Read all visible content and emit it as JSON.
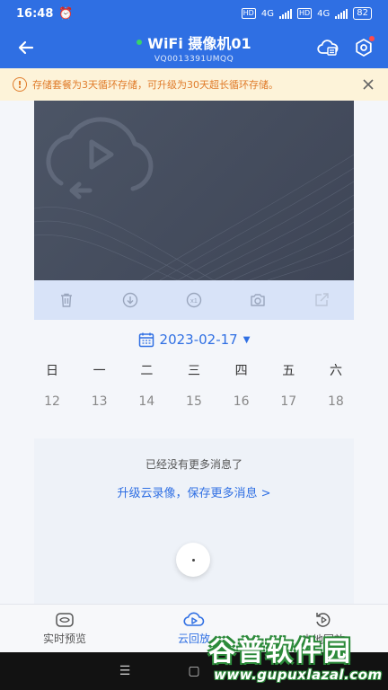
{
  "status_bar": {
    "time": "16:48",
    "net1": "4G",
    "net2": "4G",
    "hd1": "HD",
    "hd2": "HD",
    "battery": "82"
  },
  "header": {
    "title": "WiFi 摄像机01",
    "subtitle": "VQ0013391UMQQ",
    "online_color": "#37d46a"
  },
  "notice": {
    "icon": "!",
    "text": "存储套餐为3天循环存储，可升级为30天超长循环存储。"
  },
  "toolbar": {
    "icons": [
      "trash-icon",
      "download-icon",
      "speed-icon",
      "camera-icon",
      "share-icon"
    ],
    "speed_label": "x1"
  },
  "calendar": {
    "date": "2023-02-17",
    "weekdays": [
      "日",
      "一",
      "二",
      "三",
      "四",
      "五",
      "六"
    ],
    "days": [
      "12",
      "13",
      "14",
      "15",
      "16",
      "17",
      "18"
    ]
  },
  "messages": {
    "no_more": "已经没有更多消息了",
    "upgrade": "升级云录像，保存更多消息 >"
  },
  "tabs": [
    {
      "label": "实时预览",
      "icon": "eye-icon",
      "active": false
    },
    {
      "label": "云回放",
      "icon": "cloud-play-icon",
      "active": true
    },
    {
      "label": "本地回放",
      "icon": "replay-icon",
      "active": false
    }
  ],
  "navbar": {
    "recents": "☰",
    "home": "▢"
  },
  "watermark": {
    "title": "谷普软件园",
    "url": "www.gupuxlazal.com"
  },
  "colors": {
    "primary": "#2f6fe3",
    "warning": "#e07c2b",
    "notice_bg": "#fdf3d9"
  }
}
